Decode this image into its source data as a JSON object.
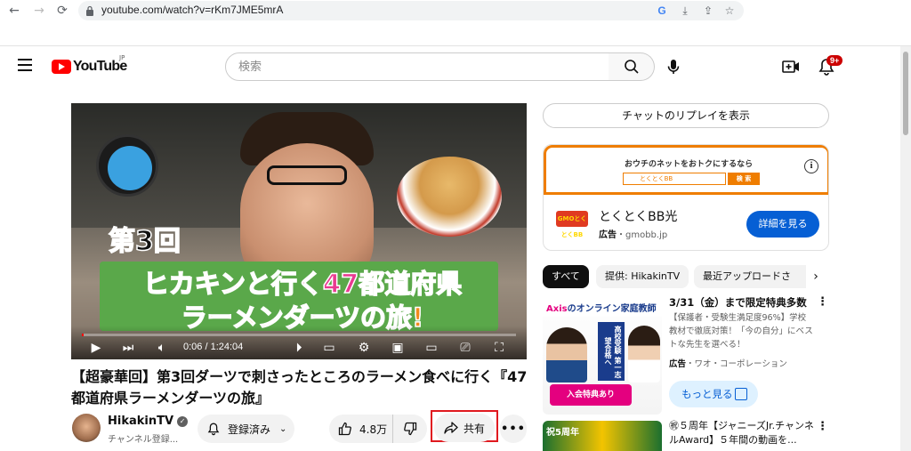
{
  "browser": {
    "url": "youtube.com/watch?v=rKm7JME5mrA",
    "nav_back": "←",
    "nav_forward": "→",
    "reload": "⟳"
  },
  "header": {
    "logo_text": "YouTube",
    "logo_region": "JP",
    "search_placeholder": "検索",
    "notification_count": "9+"
  },
  "video": {
    "overlay_number": "第3回",
    "overlay_line1": "ヒカキンと行く47都道府県",
    "overlay_line2": "ラーメンダーツの旅!",
    "time_display": "0:06 / 1:24:04",
    "progress_fraction": 0.001
  },
  "meta": {
    "title": "【超豪華回】第3回ダーツで刺さったところのラーメン食べに行く『47都道府県ラーメンダーツの旅』",
    "channel_name": "HikakinTV",
    "subscriber_text": "チャンネル登録...",
    "subscribe_label": "登録済み",
    "like_count": "4.8万",
    "share_label": "共有"
  },
  "sidebar": {
    "chat_replay": "チャットのリプレイを表示",
    "ad": {
      "banner_text": "おウチのネットをおトクにするなら",
      "search_box_text": "とくとくBB",
      "search_btn": "検 索",
      "logo_text": "GMOとくとくBB",
      "name": "とくとくBB光",
      "ad_label": "広告",
      "domain": "・gmobb.jp",
      "cta": "詳細を見る"
    },
    "chips": [
      {
        "label": "すべて"
      },
      {
        "label": "提供: HikakinTV"
      },
      {
        "label": "最近アップロードさ"
      }
    ],
    "rec1": {
      "thumb_header_a": "Axis",
      "thumb_header_b": "のオンライン家庭教師",
      "thumb_vertical": "高校受験 第一志望合格へ",
      "thumb_tag": "入会特典あり",
      "title": "3/31（金）まで限定特典多数",
      "desc": "【保護者・受験生満足度96%】学校教材で徹底対策！「今の自分」にベストな先生を選べる！",
      "ad_label": "広告",
      "advertiser": "・ワオ・コーポレーション",
      "more_label": "もっと見る"
    },
    "rec2": {
      "thumb_text": "祝5周年",
      "title": "㊗５周年【ジャニーズJr.チャンネルAward】５年間の動画を..."
    }
  }
}
